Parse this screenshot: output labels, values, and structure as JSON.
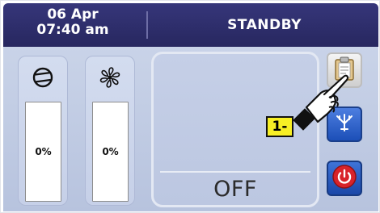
{
  "header": {
    "date": "06 Apr",
    "time": "07:40 am",
    "status": "STANDBY"
  },
  "meters": [
    {
      "icon": "compressor-icon",
      "value_label": "0%",
      "level_percent": 0
    },
    {
      "icon": "fan-icon",
      "value_label": "0%",
      "level_percent": 0
    }
  ],
  "center": {
    "mode": "OFF"
  },
  "buttons": [
    {
      "icon": "clipboard-icon"
    },
    {
      "icon": "defrost-icon"
    },
    {
      "icon": "power-icon"
    }
  ],
  "callout": {
    "label": "1-"
  },
  "colors": {
    "header_bg": "#2e2e6e",
    "panel_bg": "#c3cde6",
    "button_blue": "#2a5fc9",
    "power_red": "#d8232a",
    "callout_yellow": "#f7ef25"
  }
}
